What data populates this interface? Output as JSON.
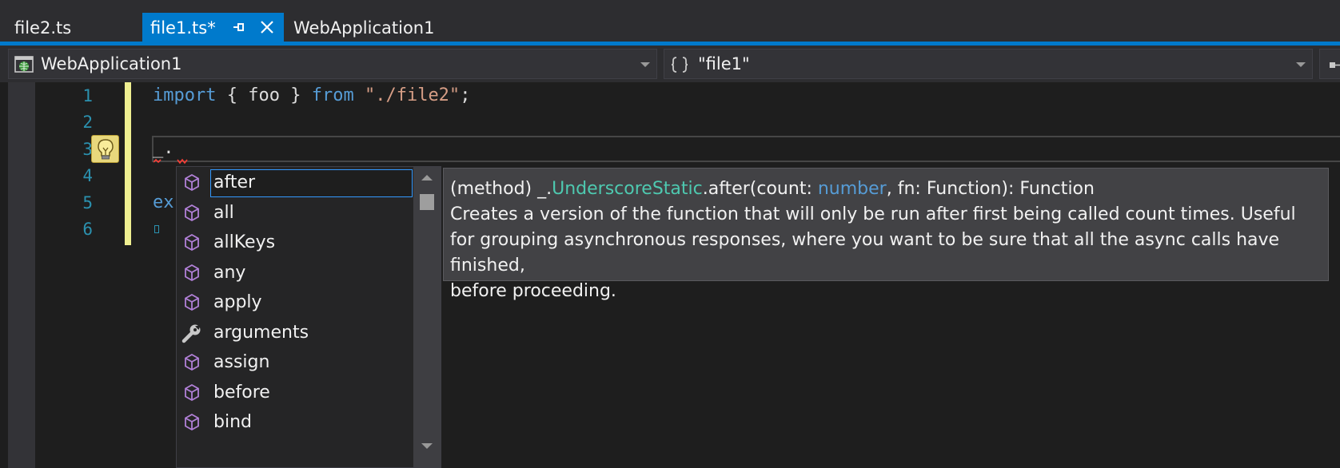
{
  "tabs": [
    {
      "label": "file2.ts",
      "active": false
    },
    {
      "label": "file1.ts*",
      "active": true
    },
    {
      "label": "WebApplication1",
      "active": false
    }
  ],
  "navbar": {
    "project": "WebApplication1",
    "scope": "\"file1\""
  },
  "editor": {
    "line_numbers": [
      "1",
      "2",
      "3",
      "4",
      "5",
      "6"
    ],
    "line1": {
      "kw_import": "import",
      "open_brace": "{",
      "ident": "foo",
      "close_brace": "}",
      "kw_from": "from",
      "string": "\"./file2\"",
      "semicolon": ";"
    },
    "line3_text": "_.",
    "line5_text": "ex"
  },
  "completion": {
    "items": [
      {
        "label": "after",
        "icon": "method-cube-icon",
        "selected": true
      },
      {
        "label": "all",
        "icon": "method-cube-icon"
      },
      {
        "label": "allKeys",
        "icon": "method-cube-icon"
      },
      {
        "label": "any",
        "icon": "method-cube-icon"
      },
      {
        "label": "apply",
        "icon": "method-cube-icon"
      },
      {
        "label": "arguments",
        "icon": "wrench-icon"
      },
      {
        "label": "assign",
        "icon": "method-cube-icon"
      },
      {
        "label": "before",
        "icon": "method-cube-icon"
      },
      {
        "label": "bind",
        "icon": "method-cube-icon"
      }
    ]
  },
  "quickinfo": {
    "prefix": "(method) _.",
    "class_name": "UnderscoreStatic",
    "sig_mid": ".after(count: ",
    "param_type": "number",
    "sig_end": ", fn: Function): Function",
    "description": [
      "Creates a version of the function that will only be run after first being called count times. Useful",
      "for grouping asynchronous responses, where you want to be sure that all the async calls have finished,",
      "before proceeding."
    ]
  },
  "colors": {
    "accent": "#007acc",
    "keyword": "#569cd6",
    "string": "#d69d85",
    "line_number": "#2b91af",
    "class": "#4ec9b0",
    "method_icon": "#b180d7"
  }
}
